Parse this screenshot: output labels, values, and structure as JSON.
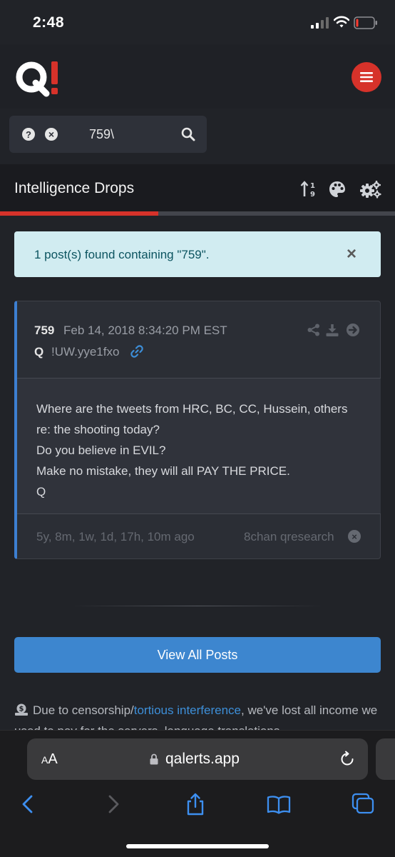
{
  "status_bar": {
    "time": "2:48"
  },
  "header": {
    "logo": "Q!",
    "menu_icon": "hamburger-icon"
  },
  "search": {
    "value": "759\\",
    "help_icon": "question-icon",
    "clear_icon": "clear-icon",
    "search_icon": "search-icon"
  },
  "section": {
    "title": "Intelligence Drops",
    "progress_fraction": 0.4
  },
  "alert": {
    "message": "1 post(s) found containing \"759\".",
    "close": "×"
  },
  "post": {
    "number": "759",
    "date": "Feb 14, 2018 8:34:20 PM EST",
    "author": "Q",
    "tripcode": "!UW.yye1fxo",
    "lines": [
      "Where are the tweets from HRC, BC, CC, Hussein, others",
      "re: the shooting today?",
      "Do you believe in EVIL?",
      "Make no mistake, they will all PAY THE PRICE.",
      "Q"
    ],
    "age": "5y, 8m, 1w, 1d, 17h, 10m ago",
    "source": "8chan qresearch"
  },
  "view_all_button": "View All Posts",
  "notice": {
    "prefix": "Due to censorship/",
    "link": "tortious interference",
    "suffix": ", we've lost all income we used to pay for the servers, language translations"
  },
  "browser": {
    "aa_label_small": "A",
    "aa_label_large": "A",
    "url": "qalerts.app"
  },
  "colors": {
    "accent_red": "#d6322a",
    "link_blue": "#3d86cf",
    "alert_bg": "#d1ecf1"
  }
}
